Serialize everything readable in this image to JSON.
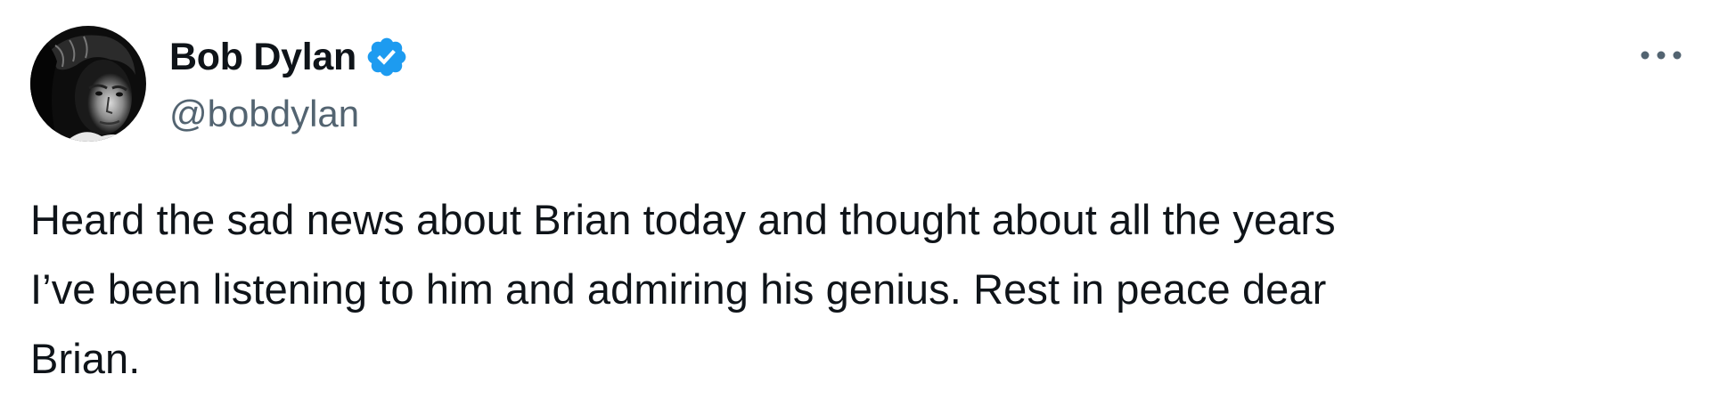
{
  "author": {
    "display_name": "Bob Dylan",
    "handle": "@bobdylan",
    "verified": true,
    "avatar_icon": "profile-photo"
  },
  "menu": {
    "icon": "more-options-icon"
  },
  "tweet": {
    "text": "Heard the sad news about Brian today and thought about all the years\nI’ve been listening to him and admiring his genius. Rest in peace dear\nBrian."
  },
  "colors": {
    "verified_blue": "#1d9bf0",
    "handle_gray": "#536471",
    "text": "#0f1419"
  }
}
